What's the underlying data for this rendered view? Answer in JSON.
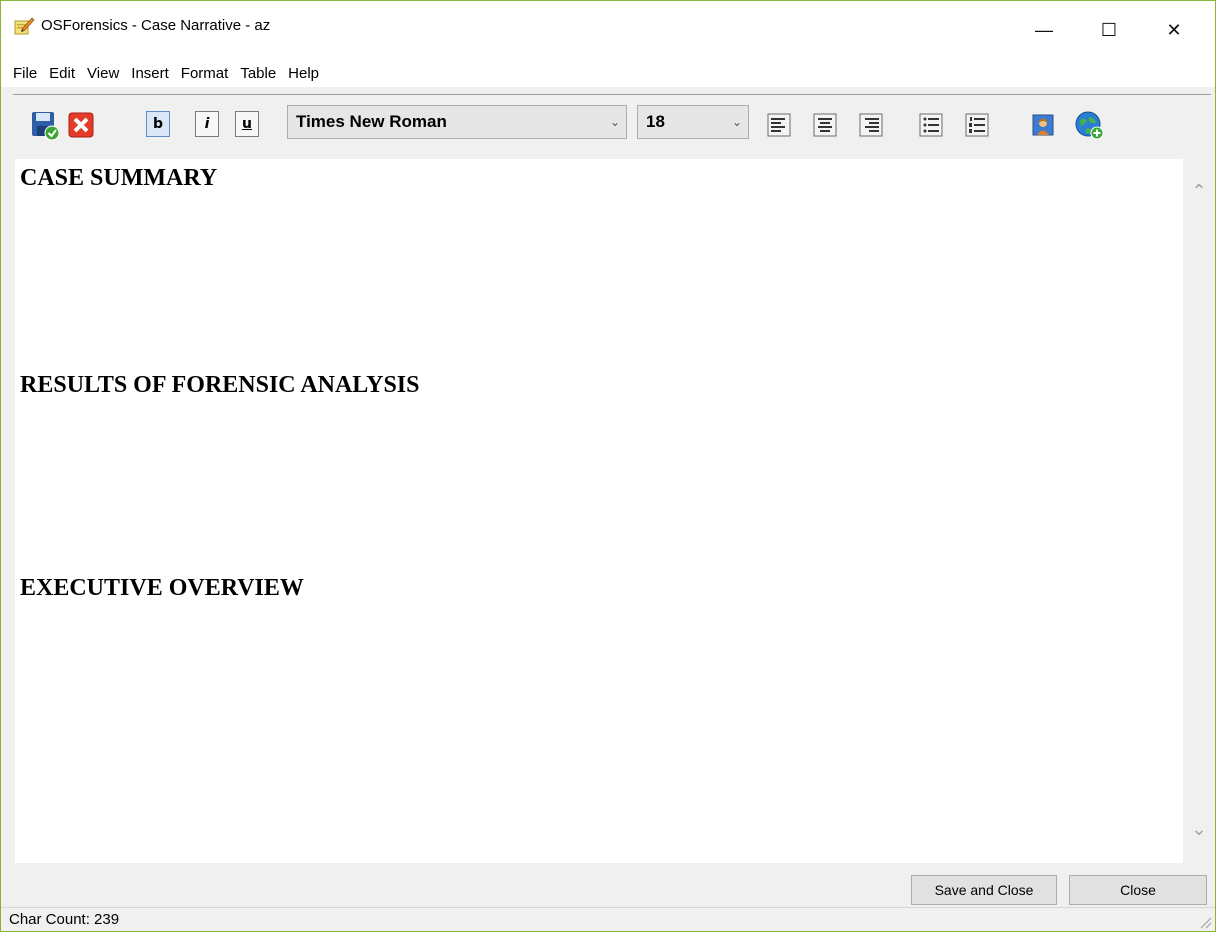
{
  "window": {
    "title": "OSForensics - Case Narrative - az",
    "minimize": "—",
    "maximize": "☐",
    "close": "✕"
  },
  "menu": [
    "File",
    "Edit",
    "View",
    "Insert",
    "Format",
    "Table",
    "Help"
  ],
  "toolbar": {
    "bold": "b",
    "italic": "i",
    "underline": "u",
    "font_name": "Times New Roman",
    "font_size": "18"
  },
  "editor": {
    "headings": [
      "CASE SUMMARY",
      "RESULTS OF FORENSIC ANALYSIS",
      "EXECUTIVE OVERVIEW"
    ]
  },
  "buttons": {
    "save_close": "Save and Close",
    "close": "Close"
  },
  "status": {
    "char_count": "Char Count: 239"
  }
}
